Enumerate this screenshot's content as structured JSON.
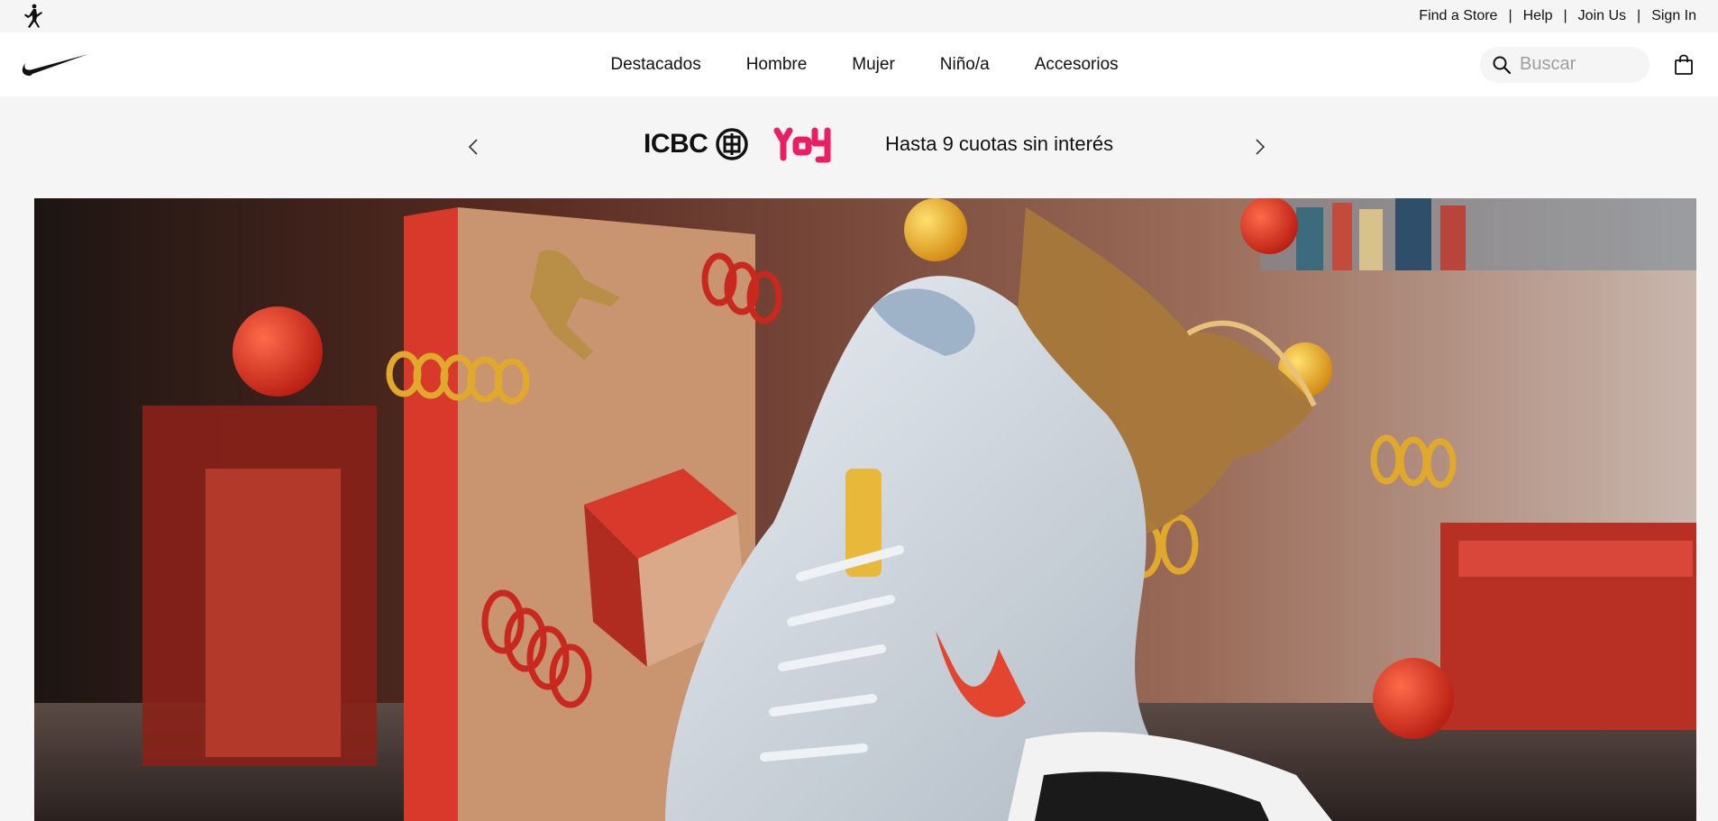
{
  "utility_bar": {
    "links": [
      "Find a Store",
      "Help",
      "Join Us",
      "Sign In"
    ],
    "separator": "|"
  },
  "main_nav": {
    "items": [
      "Destacados",
      "Hombre",
      "Mujer",
      "Niño/a",
      "Accesorios"
    ],
    "search_placeholder": "Buscar"
  },
  "promo": {
    "bank_name": "ICBC",
    "partner_name": "YOY",
    "text": "Hasta 9 cuotas sin interés"
  },
  "colors": {
    "background": "#f5f5f5",
    "nav_background": "#ffffff",
    "text": "#111111",
    "placeholder": "#9e9e9e",
    "yoy_accent": "#e91e63",
    "hero_accent_red": "#d8392a",
    "hero_accent_gold": "#e0a92c"
  },
  "icons": {
    "jordan": "jumpman-logo",
    "nike": "swoosh-logo",
    "search": "search-icon",
    "bag": "bag-icon",
    "prev": "chevron-left-icon",
    "next": "chevron-right-icon"
  }
}
